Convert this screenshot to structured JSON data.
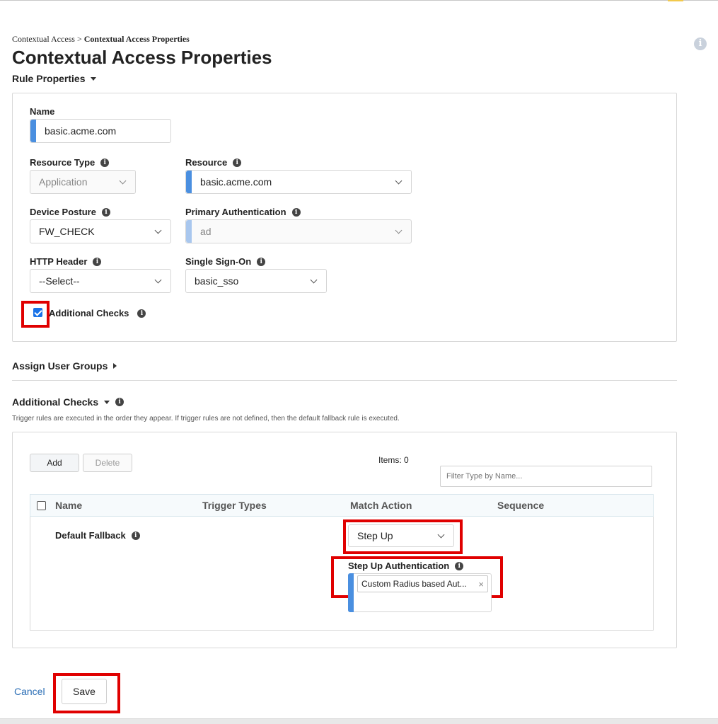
{
  "breadcrumb": {
    "parent": "Contextual Access",
    "separator": " > ",
    "current": "Contextual Access Properties"
  },
  "page_title": "Contextual Access Properties",
  "rule_properties": {
    "title": "Rule Properties",
    "name": {
      "label": "Name",
      "value": "basic.acme.com"
    },
    "resource_type": {
      "label": "Resource Type",
      "value": "Application"
    },
    "resource": {
      "label": "Resource",
      "value": "basic.acme.com"
    },
    "device_posture": {
      "label": "Device Posture",
      "value": "FW_CHECK"
    },
    "primary_authentication": {
      "label": "Primary Authentication",
      "value": "ad"
    },
    "http_header": {
      "label": "HTTP Header",
      "value": "--Select--"
    },
    "single_sign_on": {
      "label": "Single Sign-On",
      "value": "basic_sso"
    },
    "additional_checks": {
      "label": "Additional Checks",
      "checked": true
    }
  },
  "assign_user_groups": {
    "title": "Assign User Groups"
  },
  "additional_checks_section": {
    "title": "Additional Checks",
    "help": "Trigger rules are executed in the order they appear. If trigger rules are not defined, then the default fallback rule is executed.",
    "add_label": "Add",
    "delete_label": "Delete",
    "items_count": "Items: 0",
    "filter_placeholder": "Filter Type by Name...",
    "columns": [
      "Name",
      "Trigger Types",
      "Match Action",
      "Sequence"
    ],
    "default_fallback": {
      "label": "Default Fallback",
      "match_action": "Step Up",
      "step_up_label": "Step Up Authentication",
      "step_up_tag": "Custom Radius based Aut..."
    }
  },
  "footer": {
    "cancel_label": "Cancel",
    "save_label": "Save"
  },
  "colors": {
    "accent": "#4a8fe0",
    "highlight": "#e00000",
    "link": "#2a6db5"
  },
  "icons": {
    "info": "info-icon",
    "dropdown": "chevron-down-icon",
    "help": "help-info-icon"
  }
}
